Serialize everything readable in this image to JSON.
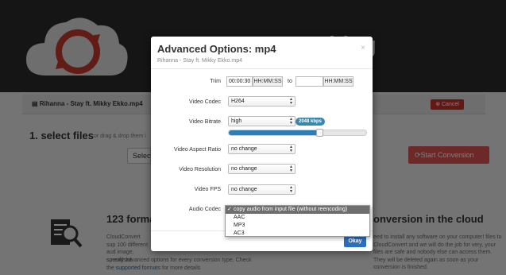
{
  "background": {
    "hero_title": "nything",
    "file_name": "Rihanna - Stay ft. Mikky Ekko.mp4",
    "cancel_label": "Cancel",
    "select_heading": "1. select files",
    "select_sub": "or drag & drop them i",
    "select_files_label": "Select fi",
    "start_label": "Start Conversion",
    "formats_heading": "123 forma",
    "cloud_heading": "onversion in the cloud",
    "left_para": "CloudConvert sup 100 different aud image, spreadshe",
    "left_para_tail_1": "specify advanced options for every conversion type. Check",
    "left_para_tail_2_prefix": "the ",
    "left_para_link": "supported formats",
    "left_para_tail_2_suffix": " for more details",
    "right_para": "eed to install any software on your computer! files to CloudConvert and we will do the job for very, your files are safe and nobody else can access them. They will be deleted again as soon as your conversion is finished."
  },
  "modal": {
    "title": "Advanced Options: mp4",
    "subtitle": "Rihanna - Stay ft. Mikky Ekko.mp4",
    "close": "×",
    "trim": {
      "label": "Trim",
      "start_value": "00:00:30",
      "start_addon": "HH:MM:SS",
      "to": "to",
      "end_value": "",
      "end_addon": "HH:MM:SS"
    },
    "video_codec": {
      "label": "Video Codec",
      "value": "H264"
    },
    "video_bitrate": {
      "label": "Video Bitrate",
      "value": "high",
      "badge": "2048 kbps",
      "slider_fraction": 0.66
    },
    "video_aspect_ratio": {
      "label": "Video Aspect Ratio",
      "value": "no change"
    },
    "video_resolution": {
      "label": "Video Resolution",
      "value": "no change"
    },
    "video_fps": {
      "label": "Video FPS",
      "value": "no change"
    },
    "audio_codec": {
      "label": "Audio Codec"
    },
    "okay_label": "Okay"
  },
  "dropdown": {
    "check": "✓",
    "options": [
      "copy audio from input file (without reencoding)",
      "AAC",
      "MP3",
      "AC3"
    ],
    "selected_index": 0
  },
  "colors": {
    "primary": "#2c6fbf",
    "danger": "#d9534f",
    "slider": "#2a7fb8",
    "badge": "#3a87ad"
  }
}
